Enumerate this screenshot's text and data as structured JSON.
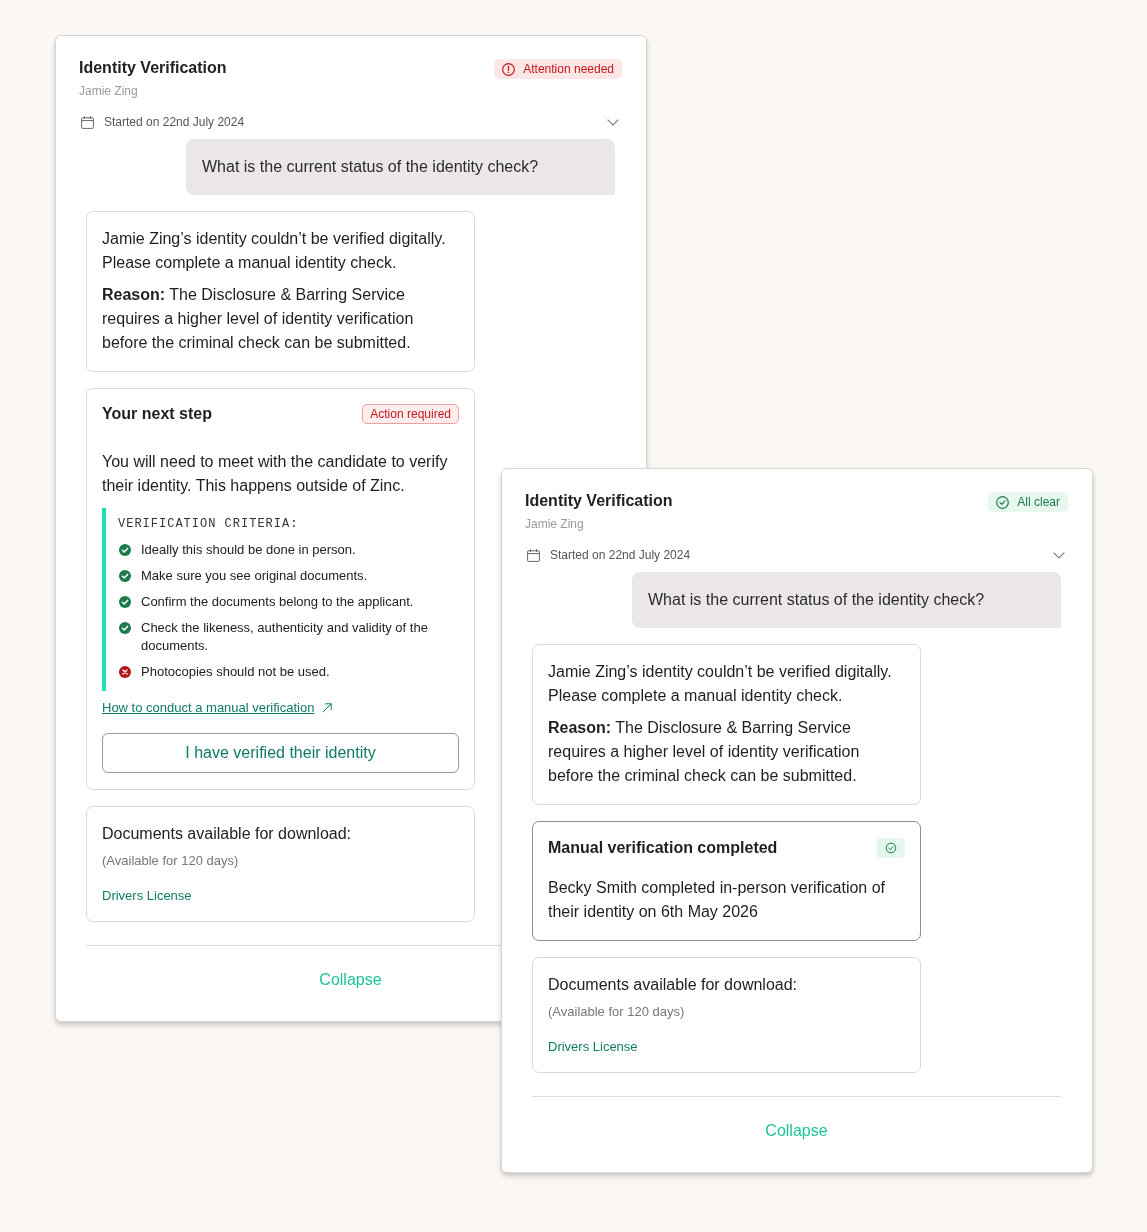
{
  "panels": [
    {
      "title": "Identity Verification",
      "candidate": "Jamie Zing",
      "status": {
        "kind": "warning",
        "label": "Attention needed"
      },
      "started": "Started on 22nd July 2024",
      "question": "What is the current status of the identity check?",
      "cards": [
        {
          "kind": "message",
          "paragraphs": [
            "Jamie Zing’s identity couldn’t be verified digitally. Please complete a manual identity check.",
            "**Reason:** The Disclosure & Barring Service requires a higher level of identity verification before the criminal check can be submitted."
          ]
        },
        {
          "kind": "next_step",
          "title": "Your next step",
          "tag": "Action required",
          "text": "You will need to meet with the candidate to verify their identity. This happens outside of Zinc.",
          "criteria_heading": "VERIFICATION CRITERIA:",
          "criteria": [
            {
              "text": "Ideally this should be done in person.",
              "passed": true
            },
            {
              "text": "Make sure you see original documents.",
              "passed": true
            },
            {
              "text": "Confirm the documents belong to the applicant.",
              "passed": true
            },
            {
              "text": "Check the likeness, authenticity and validity of the documents.",
              "passed": true
            },
            {
              "text": "Photocopies should not be used.",
              "passed": false
            }
          ],
          "link": "How to conduct a manual verification",
          "button": "I have verified their identity"
        },
        {
          "kind": "documents",
          "title": "Documents available for download:",
          "note": "(Available for 120 days)",
          "documents": [
            "Drivers License"
          ]
        }
      ],
      "collapse": "Collapse"
    },
    {
      "title": "Identity Verification",
      "candidate": "Jamie Zing",
      "status": {
        "kind": "success",
        "label": "All clear"
      },
      "started": "Started on 22nd July 2024",
      "question": "What is the current status of the identity check?",
      "cards": [
        {
          "kind": "message",
          "paragraphs": [
            "Jamie Zing’s identity couldn’t be verified digitally. Please complete a manual identity check.",
            "**Reason:** The Disclosure & Barring Service requires a higher level of identity verification before the criminal check can be submitted."
          ]
        },
        {
          "kind": "completed",
          "title": "Manual verification completed",
          "text": "Becky Smith completed in-person verification of their identity on 6th May 2026"
        },
        {
          "kind": "documents",
          "title": "Documents available for download:",
          "note": "(Available for 120 days)",
          "documents": [
            "Drivers License"
          ]
        }
      ],
      "collapse": "Collapse"
    }
  ]
}
